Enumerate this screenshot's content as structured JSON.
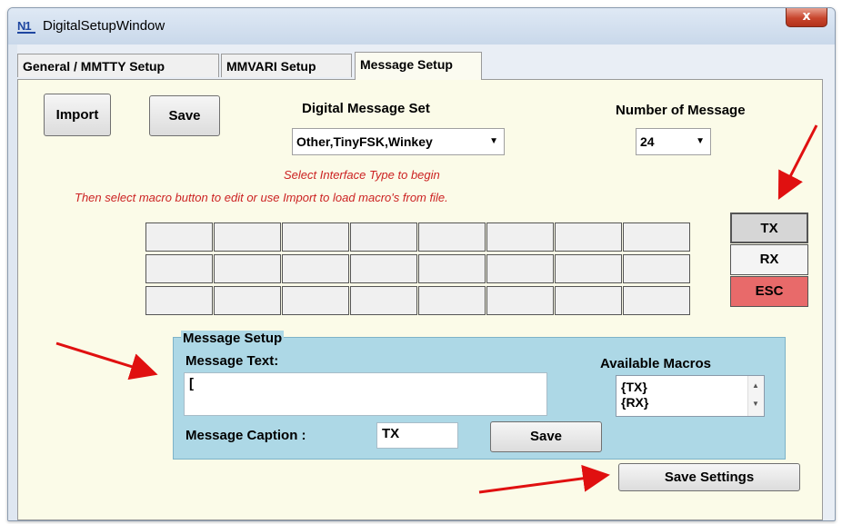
{
  "window": {
    "title": "DigitalSetupWindow",
    "icon": "N1MM-logo",
    "close_label": "x"
  },
  "tabs": [
    {
      "label": "General / MMTTY Setup",
      "active": false
    },
    {
      "label": "MMVARI Setup",
      "active": false
    },
    {
      "label": "Message Setup",
      "active": true
    }
  ],
  "toolbar": {
    "import_label": "Import",
    "save_label": "Save"
  },
  "message_set": {
    "label": "Digital Message Set",
    "value": "Other,TinyFSK,Winkey"
  },
  "message_count": {
    "label": "Number of Message",
    "value": "24"
  },
  "hints": {
    "line1": "Select Interface Type to begin",
    "line2": "Then select macro button to edit or use Import to load macro's from file."
  },
  "macro_grid": {
    "rows": 3,
    "cols": 8
  },
  "side_buttons": [
    {
      "label": "TX",
      "color": "#d6d6d6"
    },
    {
      "label": "RX",
      "color": "#f4f4f4"
    },
    {
      "label": "ESC",
      "color": "#e86a6a"
    }
  ],
  "message_setup": {
    "group_title": "Message Setup",
    "text_label": "Message Text:",
    "text_value": "[",
    "macros_label": "Available Macros",
    "macros": [
      "{TX}",
      "{RX}"
    ],
    "caption_label": "Message Caption :",
    "caption_value": "TX",
    "save_label": "Save"
  },
  "footer": {
    "save_settings_label": "Save Settings"
  },
  "colors": {
    "panel_bg": "#fbfbe8",
    "group_bg": "#add8e6",
    "hint_text": "#cc2222",
    "arrow": "#e01010"
  }
}
